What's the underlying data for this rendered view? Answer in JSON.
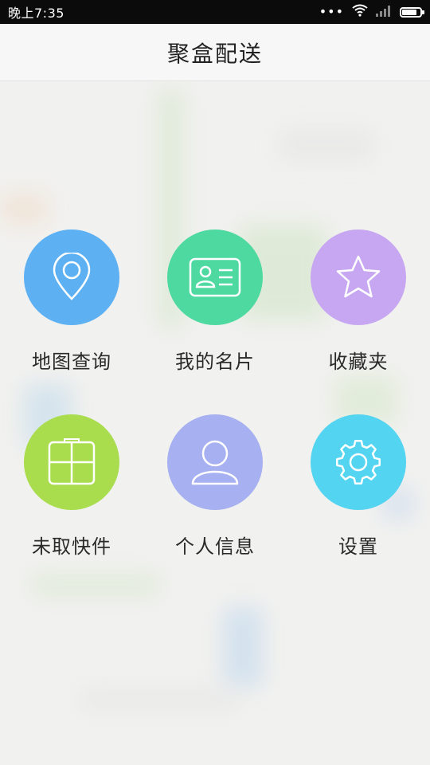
{
  "status_bar": {
    "time": "晚上7:35",
    "battery_level": 0.85
  },
  "header": {
    "title": "聚盒配送"
  },
  "menu": [
    {
      "label": "地图查询",
      "icon": "map-pin-icon",
      "color": "#5DB1F3"
    },
    {
      "label": "我的名片",
      "icon": "id-card-icon",
      "color": "#4ED9A1"
    },
    {
      "label": "收藏夹",
      "icon": "star-icon",
      "color": "#C7A7F1"
    },
    {
      "label": "未取快件",
      "icon": "package-icon",
      "color": "#A9DD4D"
    },
    {
      "label": "个人信息",
      "icon": "person-icon",
      "color": "#A7B0F0"
    },
    {
      "label": "设置",
      "icon": "gear-icon",
      "color": "#53D4F0"
    }
  ]
}
